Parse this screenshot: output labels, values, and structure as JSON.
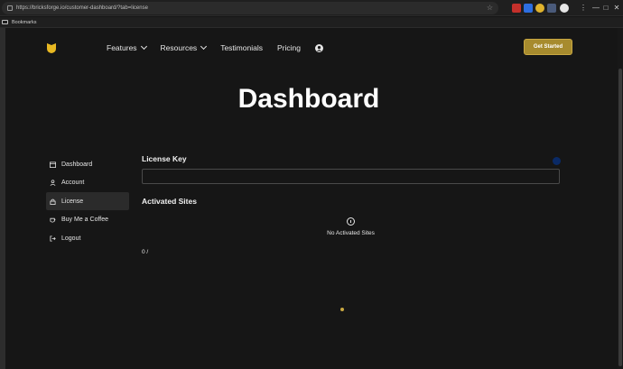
{
  "browser": {
    "url": "https://bricksforge.io/customer-dashboard/?tab=license",
    "bookmarks_label": "Bookmarks",
    "window_controls": [
      "—",
      "□",
      "✕"
    ]
  },
  "site": {
    "nav": {
      "features": "Features",
      "resources": "Resources",
      "testimonials": "Testimonials",
      "pricing": "Pricing"
    },
    "cta": "Get Started",
    "page_title": "Dashboard"
  },
  "sidebar": {
    "items": [
      {
        "label": "Dashboard",
        "icon": "calendar-icon"
      },
      {
        "label": "Account",
        "icon": "user-icon"
      },
      {
        "label": "License",
        "icon": "lock-icon",
        "active": true
      },
      {
        "label": "Buy Me a Coffee",
        "icon": "coffee-icon"
      },
      {
        "label": "Logout",
        "icon": "logout-icon"
      }
    ]
  },
  "main": {
    "license_title": "License Key",
    "license_value": "",
    "sites_title": "Activated Sites",
    "empty_text": "No Activated Sites",
    "count": "0 /"
  },
  "colors": {
    "accent": "#a78b2e",
    "background": "#161616"
  }
}
